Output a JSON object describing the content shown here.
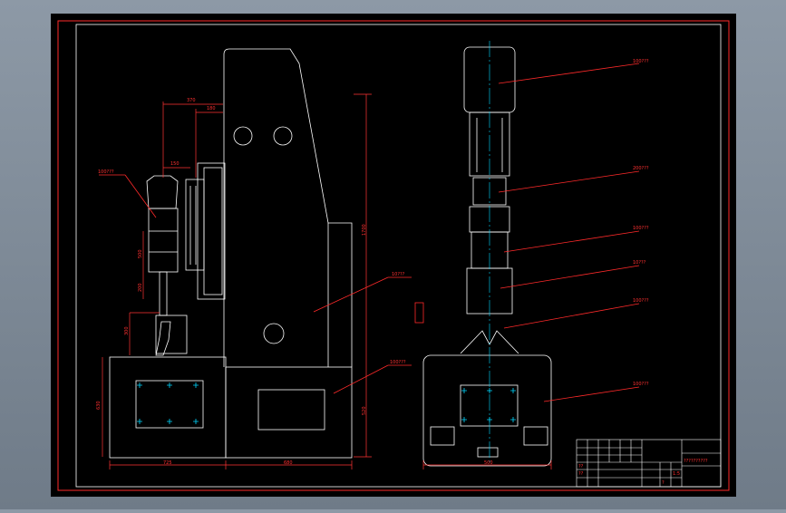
{
  "drawing": {
    "colors": {
      "background": "#000000",
      "outline": "#ffffff",
      "border": "#ff2a2a",
      "leader": "#ff2a2a",
      "dimension": "#ff3333",
      "center_mark": "#00d8ff",
      "text": "#ff3030"
    },
    "callouts_left": [
      {
        "id": "gear-motor",
        "text": "100???"
      },
      {
        "id": "column-body",
        "text": "10???"
      },
      {
        "id": "base-left",
        "text": "100???"
      }
    ],
    "callouts_right": [
      {
        "id": "motor-housing",
        "text": "100???"
      },
      {
        "id": "spindle-motor",
        "text": "200???"
      },
      {
        "id": "drive-unit",
        "text": "100???"
      },
      {
        "id": "clamp",
        "text": "10???"
      },
      {
        "id": "linkage",
        "text": "100???"
      },
      {
        "id": "base-right",
        "text": "100???"
      }
    ],
    "dimensions": {
      "top_width_outer": "370",
      "top_width_inner": "180",
      "head_width": "150",
      "total_height": "1700",
      "upper_height": "300",
      "mid_height": "500",
      "lower_height": "200",
      "base_height": "520",
      "left_base_height": "630",
      "right_base_height": "600",
      "bottom_left": "725",
      "bottom_right": "680",
      "right_view_width": "500"
    },
    "title_block": {
      "title": "??????????",
      "scale_label": "1:5",
      "sheet_label": "?",
      "designer": "??",
      "checker": "??"
    }
  }
}
